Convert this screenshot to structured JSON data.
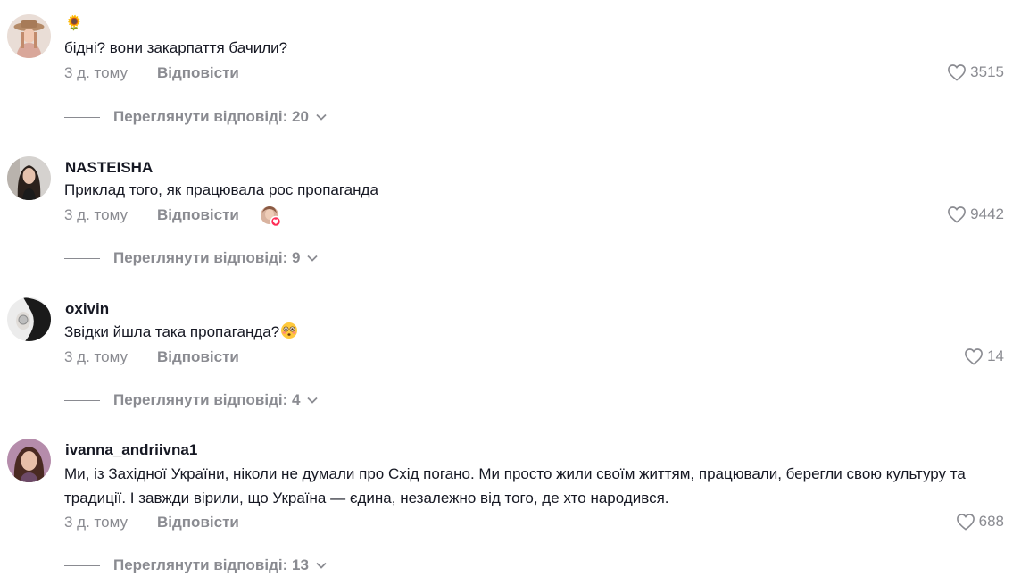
{
  "comments": [
    {
      "username": "🌻",
      "text": "бідні? вони закарпаття бачили?",
      "time": "3 д. тому",
      "reply_label": "Відповісти",
      "likes": "3515",
      "view_replies": "Переглянути відповіді: 20"
    },
    {
      "username": "NASTEISHA",
      "text": "Приклад того, як працювала рос пропаганда",
      "time": "3 д. тому",
      "reply_label": "Відповісти",
      "likes": "9442",
      "view_replies": "Переглянути відповіді: 9"
    },
    {
      "username": "oxivin",
      "text": "Звідки йшла така пропаганда?",
      "time": "3 д. тому",
      "reply_label": "Відповісти",
      "likes": "14",
      "view_replies": "Переглянути відповіді: 4"
    },
    {
      "username": "ivanna_andriivna1",
      "text": "Ми, із Західної України, ніколи не думали про Схід погано. Ми просто жили своїм життям, працювали, берегли свою культуру та традиції. І завжди вірили, що Україна — єдина, незалежно від того, де хто народився.",
      "time": "3 д. тому",
      "reply_label": "Відповісти",
      "likes": "688",
      "view_replies": "Переглянути відповіді: 13"
    }
  ],
  "icons": {
    "like": "heart-outline-icon",
    "expand": "chevron-down-icon",
    "emoji": "flushed-face-emoji",
    "creator_liked": "creator-liked-badge"
  },
  "colors": {
    "text": "#161823",
    "muted": "#8a8b91",
    "like_badge": "#fe2c55"
  }
}
